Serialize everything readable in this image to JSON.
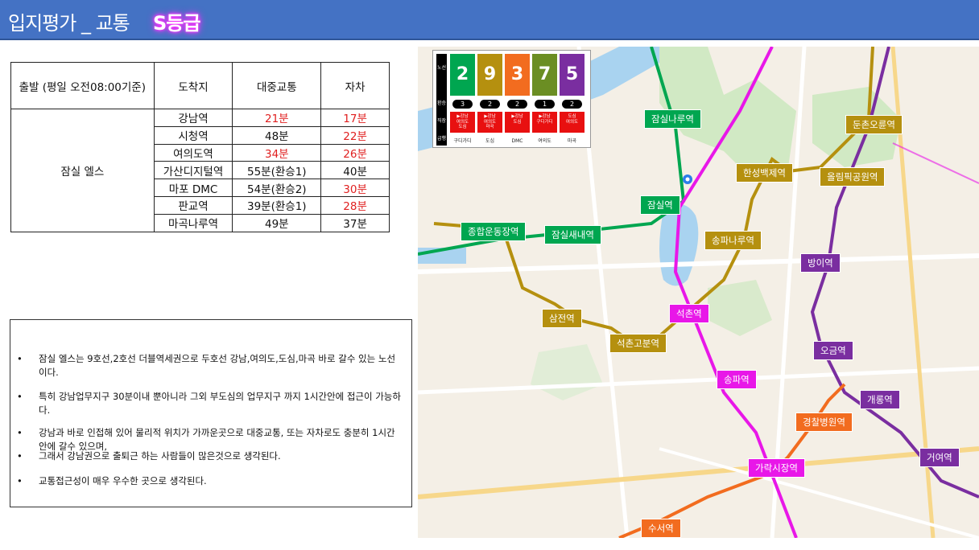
{
  "header": {
    "title": "입지평가 _ 교통",
    "grade": "S등급"
  },
  "table": {
    "headers": [
      "출발 (평일 오전08:00기준)",
      "도착지",
      "대중교통",
      "자차"
    ],
    "origin": "잠실 엘스",
    "rows": [
      {
        "dest": "강남역",
        "transit": "21분",
        "car": "17분",
        "transit_red": true,
        "car_red": true
      },
      {
        "dest": "시청역",
        "transit": "48분",
        "car": "22분",
        "transit_red": false,
        "car_red": true
      },
      {
        "dest": "여의도역",
        "transit": "34분",
        "car": "26분",
        "transit_red": true,
        "car_red": true
      },
      {
        "dest": "가산디지털역",
        "transit": "55분(환승1)",
        "car": "40분",
        "transit_red": false,
        "car_red": false
      },
      {
        "dest": "마포 DMC",
        "transit": "54분(환승2)",
        "car": "30분",
        "transit_red": false,
        "car_red": true
      },
      {
        "dest": "판교역",
        "transit": "39분(환승1)",
        "car": "28분",
        "transit_red": false,
        "car_red": true
      },
      {
        "dest": "마곡나루역",
        "transit": "49분",
        "car": "37분",
        "transit_red": false,
        "car_red": false
      }
    ]
  },
  "notes": [
    {
      "bullet": "•",
      "text": "잠실 엘스는 9호선,2호선 더블역세권으로 두호선 강남,여의도,도심,마곡 바로 갈수 있는 노선이다."
    },
    {
      "bullet": "•",
      "text": "특히 강남업무지구 30분이내 뿐아니라 그외 부도심의 업무지구 까지 1시간안에 접근이 가능하다."
    },
    {
      "bullet": "•",
      "text": "강남과 바로 인접해 있어 물리적 위치가 가까운곳으로 대중교통, 또는 자차로도 충분히 1시간안에 갈수 있으며,"
    },
    {
      "bullet": "•",
      "text": "그래서 강남권으로 출퇴근 하는 사람들이 많은것으로 생각된다."
    },
    {
      "bullet": "•",
      "text": "교통접근성이 매우 우수한 곳으로 생각된다."
    }
  ],
  "map": {
    "stations": [
      {
        "name": "잠실나루역",
        "line": "green"
      },
      {
        "name": "둔촌오륜역",
        "line": "gold"
      },
      {
        "name": "한성백제역",
        "line": "gold"
      },
      {
        "name": "올림픽공원역",
        "line": "gold"
      },
      {
        "name": "잠실역",
        "line": "green"
      },
      {
        "name": "종합운동장역",
        "line": "green"
      },
      {
        "name": "잠실새내역",
        "line": "green"
      },
      {
        "name": "송파나루역",
        "line": "gold"
      },
      {
        "name": "방이역",
        "line": "purple"
      },
      {
        "name": "삼전역",
        "line": "gold"
      },
      {
        "name": "석촌역",
        "line": "magenta"
      },
      {
        "name": "석촌고분역",
        "line": "gold"
      },
      {
        "name": "오금역",
        "line": "purple"
      },
      {
        "name": "송파역",
        "line": "magenta"
      },
      {
        "name": "개롱역",
        "line": "purple"
      },
      {
        "name": "경찰병원역",
        "line": "orange"
      },
      {
        "name": "거여역",
        "line": "purple"
      },
      {
        "name": "가락시장역",
        "line": "magenta"
      },
      {
        "name": "수서역",
        "line": "orange"
      }
    ],
    "legend": {
      "header": [
        "노선",
        "환승",
        "직장",
        "급행"
      ],
      "lines": [
        {
          "num": "2",
          "color": "#00a650",
          "transfers": "3",
          "route": "▶강남\n여의도\n도심",
          "dest": "구디가디"
        },
        {
          "num": "9",
          "color": "#b5900f",
          "transfers": "2",
          "route": "▶강남\n여의도\n마곡",
          "dest": "도심"
        },
        {
          "num": "3",
          "color": "#f26c1f",
          "transfers": "2",
          "route": "▶강남\n도심",
          "dest": "DMC"
        },
        {
          "num": "7",
          "color": "#6b8e23",
          "transfers": "1",
          "route": "▶강남\n구디가디",
          "dest": "여의도"
        },
        {
          "num": "5",
          "color": "#7a2ea0",
          "transfers": "2",
          "route": "도심\n여의도",
          "dest": "마곡"
        }
      ]
    }
  }
}
